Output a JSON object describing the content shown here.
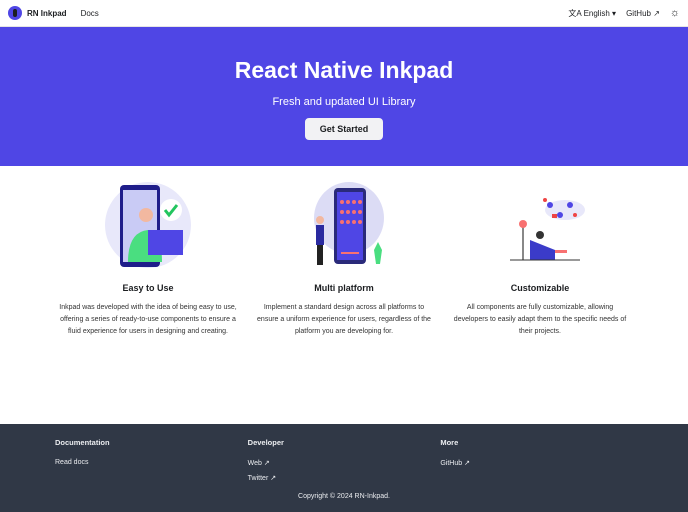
{
  "nav": {
    "brand": "RN Inkpad",
    "docs": "Docs",
    "language": "English",
    "github": "GitHub",
    "translate_icon": "文A",
    "ext_icon": "↗",
    "theme_icon": "☼"
  },
  "hero": {
    "title": "React Native Inkpad",
    "subtitle": "Fresh and updated UI Library",
    "cta": "Get Started",
    "bg": "#4f46e5"
  },
  "features": [
    {
      "title": "Easy to Use",
      "text": "Inkpad was developed with the idea of being easy to use, offering a series of ready-to-use components to ensure a fluid experience for users in designing and creating."
    },
    {
      "title": "Multi platform",
      "text": "Implement a standard design across all platforms to ensure a uniform experience for users, regardless of the platform you are developing for."
    },
    {
      "title": "Customizable",
      "text": "All components are fully customizable, allowing developers to easily adapt them to the specific needs of their projects."
    }
  ],
  "footer": {
    "cols": [
      {
        "title": "Documentation",
        "links": [
          "Read docs"
        ]
      },
      {
        "title": "Developer",
        "links": [
          "Web ↗",
          "Twitter ↗"
        ]
      },
      {
        "title": "More",
        "links": [
          "GitHub ↗"
        ]
      }
    ],
    "copyright": "Copyright © 2024 RN-Inkpad."
  }
}
